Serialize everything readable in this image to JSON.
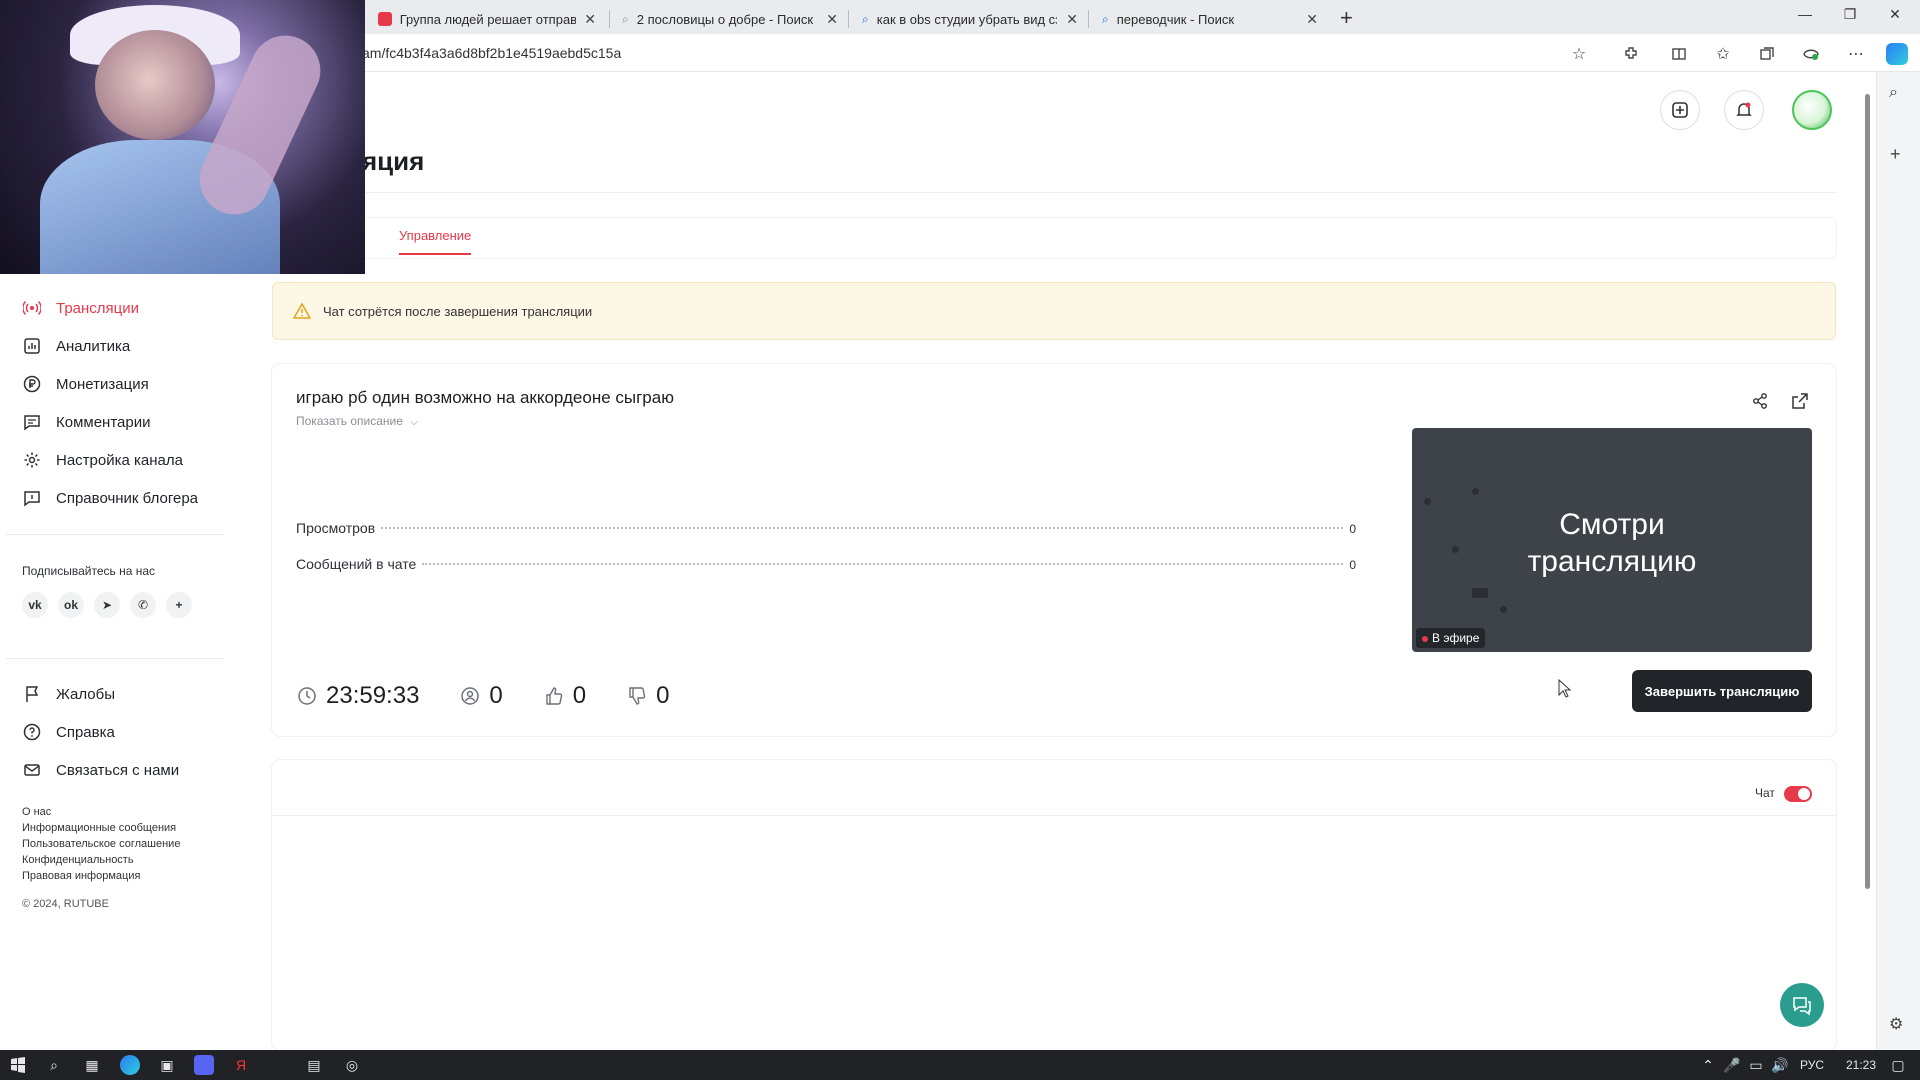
{
  "browser": {
    "tabs": [
      {
        "title": "Группа людей решает отправ"
      },
      {
        "title": "2 пословицы о добре - Поиск"
      },
      {
        "title": "как в obs студии убрать вид сза"
      },
      {
        "title": "переводчик - Поиск"
      }
    ],
    "url": "am/fc4b3f4a3a6d8bf2b1e4519aebd5c15a"
  },
  "page": {
    "title": "яция",
    "tabs": [
      {
        "label": "Управление"
      }
    ],
    "warning": "Чат сотрётся после завершения трансляции"
  },
  "sidebar": {
    "items": [
      {
        "label": "Трансляции",
        "icon": "broadcast-icon",
        "active": true
      },
      {
        "label": "Аналитика",
        "icon": "chart-icon"
      },
      {
        "label": "Монетизация",
        "icon": "ruble-icon"
      },
      {
        "label": "Комментарии",
        "icon": "comment-icon"
      },
      {
        "label": "Настройка канала",
        "icon": "gear-icon"
      },
      {
        "label": "Справочник блогера",
        "icon": "info-icon"
      }
    ],
    "subscribe_label": "Подписывайтесь на нас",
    "social": [
      "vk",
      "ok",
      "telegram",
      "viber",
      "more"
    ],
    "support_items": [
      {
        "label": "Жалобы",
        "icon": "flag-icon"
      },
      {
        "label": "Справка",
        "icon": "help-icon"
      },
      {
        "label": "Связаться с нами",
        "icon": "mail-icon"
      }
    ],
    "footer_links": [
      "О нас",
      "Информационные сообщения",
      "Пользовательское соглашение",
      "Конфиденциальность",
      "Правовая информация"
    ],
    "copyright": "© 2024, RUTUBE"
  },
  "stream": {
    "title": "играю рб один возможно на аккордеоне сыграю",
    "show_description": "Показать описание",
    "stats": [
      {
        "label": "Просмотров",
        "value": "0"
      },
      {
        "label": "Сообщений в чате",
        "value": "0"
      }
    ],
    "duration": "23:59:33",
    "viewers": "0",
    "likes": "0",
    "dislikes": "0",
    "preview_text_line1": "Смотри",
    "preview_text_line2": "трансляцию",
    "live_badge": "В эфире",
    "end_button": "Завершить трансляцию"
  },
  "chat": {
    "label": "Чат",
    "enabled": true
  },
  "taskbar": {
    "lang": "РУС",
    "time": "21:23"
  },
  "colors": {
    "accent": "#e6394a",
    "dark_button": "#212529",
    "warning_bg": "#fdf7e6"
  }
}
